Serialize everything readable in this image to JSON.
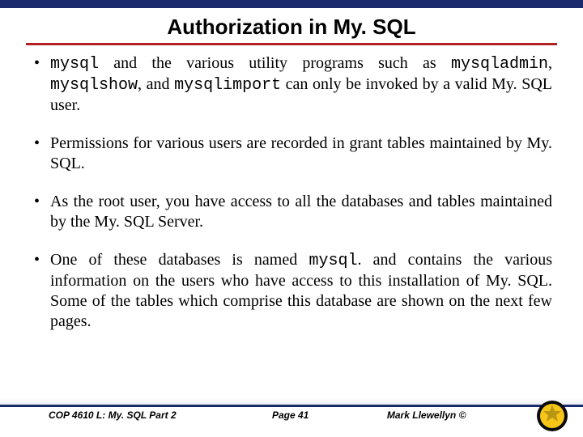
{
  "title": "Authorization in My. SQL",
  "bullets": {
    "b1": {
      "code1": "mysql",
      "t1": " and the various utility programs such as ",
      "code2": "mysqladmin",
      "t2": ", ",
      "code3": "mysqlshow",
      "t3": ", and ",
      "code4": "mysqlimport",
      "t4": " can only be invoked by a valid My. SQL user."
    },
    "b2": "Permissions for various users are recorded in grant tables maintained by My. SQL.",
    "b3": "As the root user, you have access to all the databases and tables maintained by the My. SQL Server.",
    "b4": {
      "t1": "One of these databases is named ",
      "code1": "mysql",
      "t2": ". and contains the various information on the users who have access to this installation of My. SQL.  Some of the tables which comprise this database are shown on the next few pages."
    }
  },
  "footer": {
    "course": "COP 4610 L: My. SQL Part 2",
    "page": "Page 41",
    "author": "Mark Llewellyn ©"
  }
}
